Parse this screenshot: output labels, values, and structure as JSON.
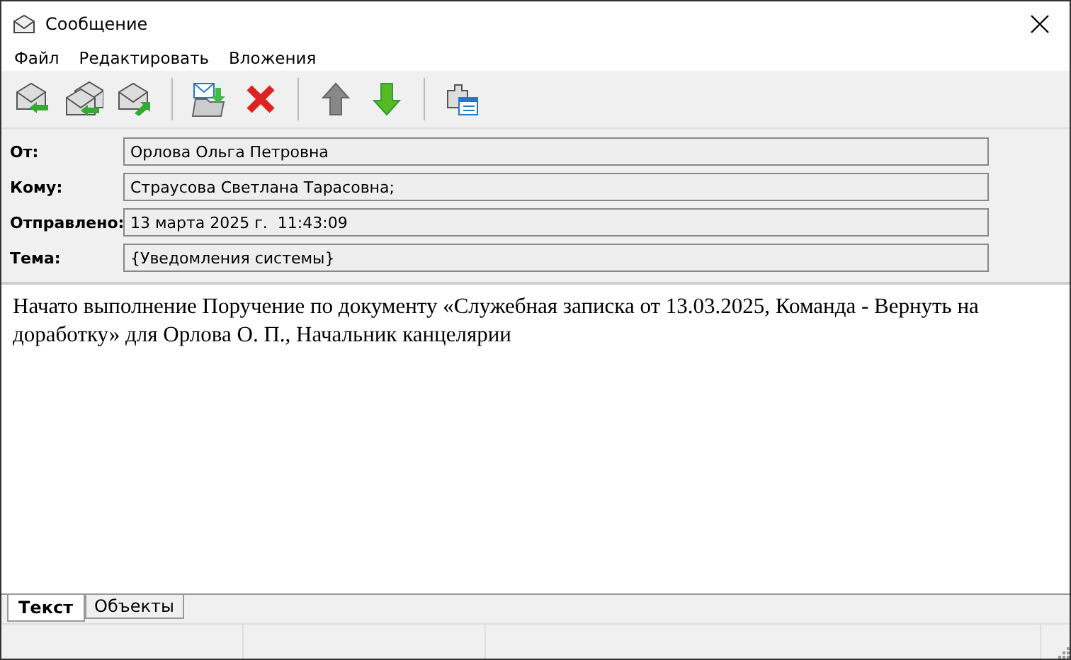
{
  "window": {
    "title": "Сообщение"
  },
  "menu": [
    "Файл",
    "Редактировать",
    "Вложения"
  ],
  "header": [
    {
      "label": "От:",
      "value": "Орлова Ольга Петровна"
    },
    {
      "label": "Кому:",
      "value": "Страусова Светлана Тарасовна;"
    },
    {
      "label": "Отправлено:",
      "value": "13 марта 2025 г.  11:43:09"
    },
    {
      "label": "Тема:",
      "value": "{Уведомления системы}"
    }
  ],
  "body": "Начато выполнение Поручение по документу «Служебная записка от 13.03.2025, Команда - Вернуть на доработку» для Орлова О. П., Начальник канцелярии",
  "tabs": [
    {
      "label": "Текст",
      "selected": true
    },
    {
      "label": "Объекты",
      "selected": false
    }
  ]
}
